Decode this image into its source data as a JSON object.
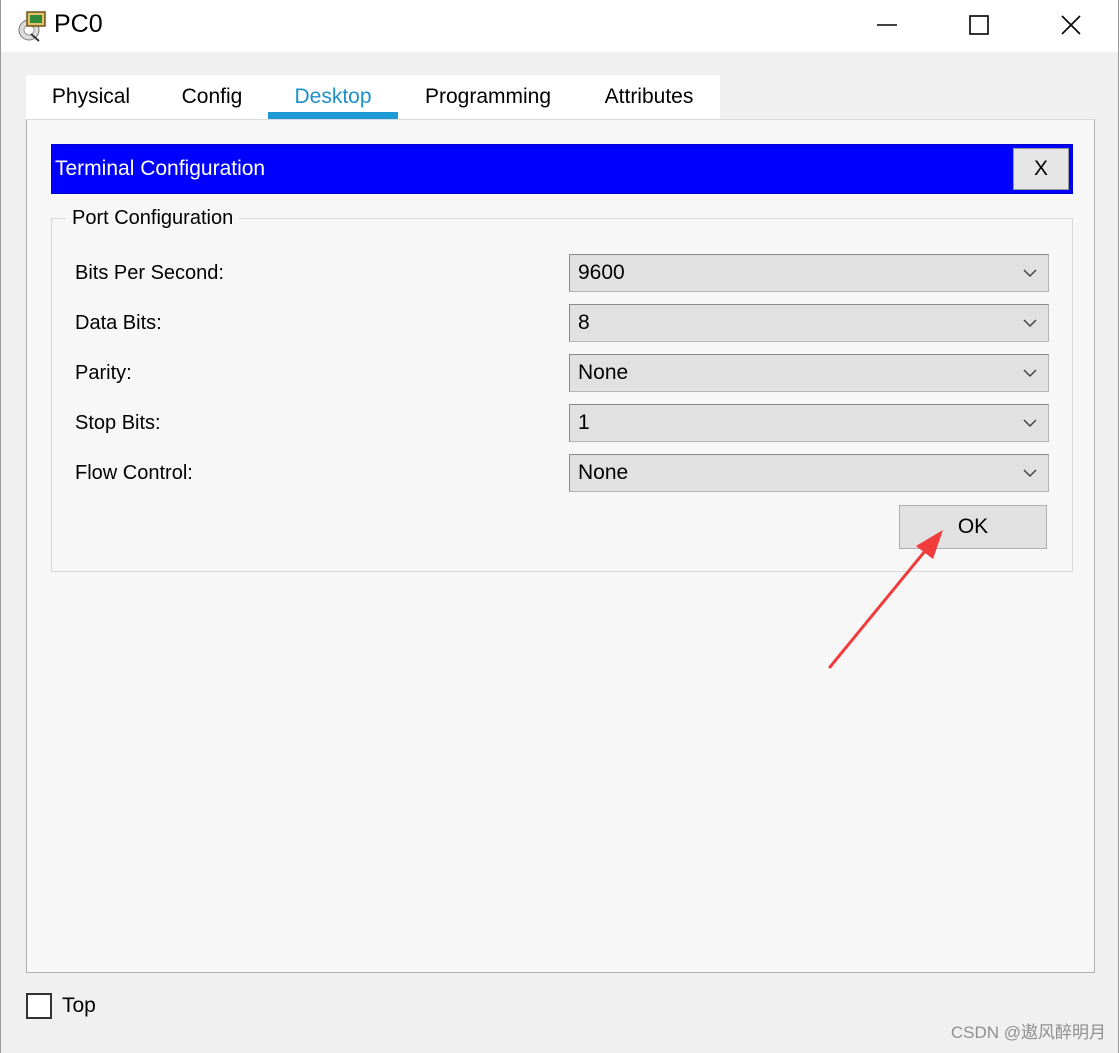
{
  "window": {
    "title": "PC0",
    "icon": "packet-tracer-pc-icon"
  },
  "title_controls": {
    "minimize_icon": "minimize-icon",
    "maximize_icon": "maximize-icon",
    "close_icon": "close-icon"
  },
  "tabs": [
    {
      "label": "Physical",
      "active": false
    },
    {
      "label": "Config",
      "active": false
    },
    {
      "label": "Desktop",
      "active": true
    },
    {
      "label": "Programming",
      "active": false
    },
    {
      "label": "Attributes",
      "active": false
    }
  ],
  "terminal": {
    "title": "Terminal Configuration",
    "close_label": "X"
  },
  "port_config": {
    "legend": "Port Configuration",
    "fields": [
      {
        "label": "Bits Per Second:",
        "value": "9600"
      },
      {
        "label": "Data Bits:",
        "value": "8"
      },
      {
        "label": "Parity:",
        "value": "None"
      },
      {
        "label": "Stop Bits:",
        "value": "1"
      },
      {
        "label": "Flow Control:",
        "value": "None"
      }
    ],
    "ok_label": "OK"
  },
  "footer": {
    "top_label": "Top",
    "top_checked": false
  },
  "watermark": "CSDN @遨风醉明月",
  "colors": {
    "header_blue": "#0000ff",
    "active_tab": "#1e90c8",
    "annotation_arrow": "#f03c3c"
  }
}
